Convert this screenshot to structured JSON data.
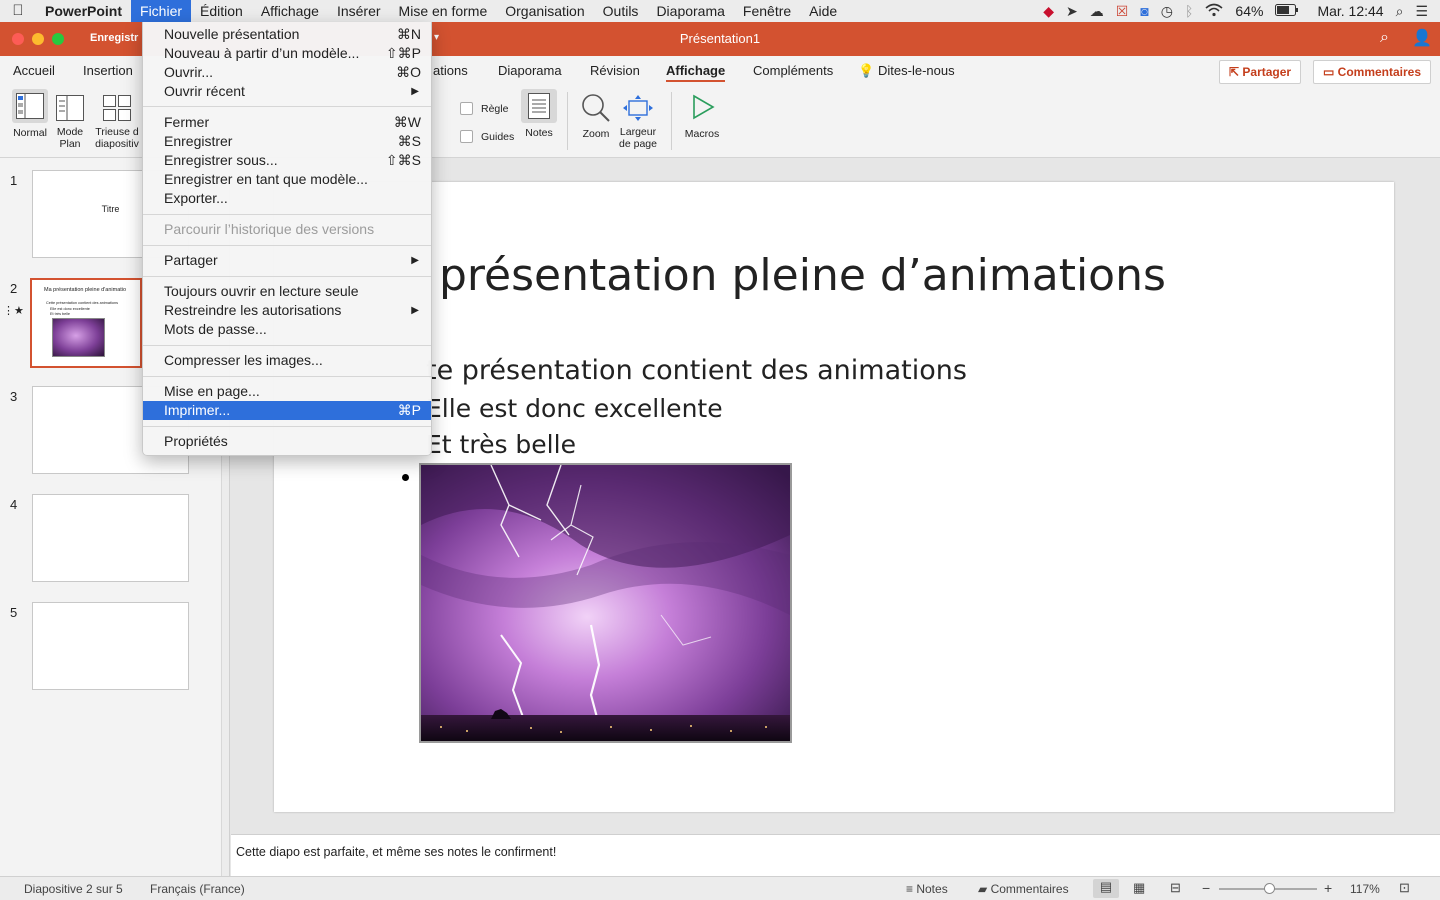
{
  "menubar": {
    "apple": "",
    "app": "PowerPoint",
    "items": [
      "Fichier",
      "Édition",
      "Affichage",
      "Insérer",
      "Mise en forme",
      "Organisation",
      "Outils",
      "Diaporama",
      "Fenêtre",
      "Aide"
    ],
    "battery": "64%",
    "clock": "Mar. 12:44"
  },
  "window": {
    "title": "Présentation1",
    "save_hint": "Enregistr"
  },
  "tabs": [
    "Accueil",
    "Insertion",
    "ations",
    "Diaporama",
    "Révision",
    "Affichage",
    "Compléments"
  ],
  "tell_me": "Dites-le-nous",
  "share": "Partager",
  "comments": "Commentaires",
  "ribbon": {
    "normal": "Normal",
    "outline": [
      "Mode",
      "Plan"
    ],
    "sorter": [
      "Trieuse d",
      "diapositiv"
    ],
    "ruler": "Règle",
    "guides": "Guides",
    "notes": "Notes",
    "zoom": "Zoom",
    "fit": [
      "Largeur",
      "de page"
    ],
    "macros": "Macros"
  },
  "thumbnails": [
    {
      "num": "1",
      "title": "Titre"
    },
    {
      "num": "2",
      "title": "Ma présentation pleine d'animatio",
      "bullets": [
        "Cette présentation contient des animations",
        "Elle est donc excellente",
        "Et très belle"
      ]
    },
    {
      "num": "3"
    },
    {
      "num": "4"
    },
    {
      "num": "5"
    }
  ],
  "slide": {
    "title": "présentation pleine d’animations",
    "bullets": [
      "te présentation contient des animations",
      "Elle est donc excellente",
      "Et très belle"
    ]
  },
  "notes_text": "Cette diapo est parfaite, et même ses notes le confirment!",
  "status": {
    "slide": "Diapositive 2 sur 5",
    "language": "Français (France)",
    "notes": "Notes",
    "comments": "Commentaires",
    "zoom": "117%"
  },
  "file_menu": [
    {
      "label": "Nouvelle présentation",
      "shortcut": "⌘N"
    },
    {
      "label": "Nouveau à partir d’un modèle...",
      "shortcut": "⇧⌘P"
    },
    {
      "label": "Ouvrir...",
      "shortcut": "⌘O"
    },
    {
      "label": "Ouvrir récent",
      "arrow": "▶"
    },
    {
      "label": "Fermer",
      "shortcut": "⌘W"
    },
    {
      "label": "Enregistrer",
      "shortcut": "⌘S"
    },
    {
      "label": "Enregistrer sous...",
      "shortcut": "⇧⌘S"
    },
    {
      "label": "Enregistrer en tant que modèle..."
    },
    {
      "label": "Exporter..."
    },
    {
      "label": "Parcourir l’historique des versions"
    },
    {
      "label": "Partager",
      "arrow": "▶"
    },
    {
      "label": "Toujours ouvrir en lecture seule"
    },
    {
      "label": "Restreindre les autorisations",
      "arrow": "▶"
    },
    {
      "label": "Mots de passe..."
    },
    {
      "label": "Compresser les images..."
    },
    {
      "label": "Mise en page..."
    },
    {
      "label": "Imprimer...",
      "shortcut": "⌘P"
    },
    {
      "label": "Propriétés"
    }
  ],
  "colors": {
    "accent": "#d35230",
    "highlight": "#2e6fdb"
  }
}
